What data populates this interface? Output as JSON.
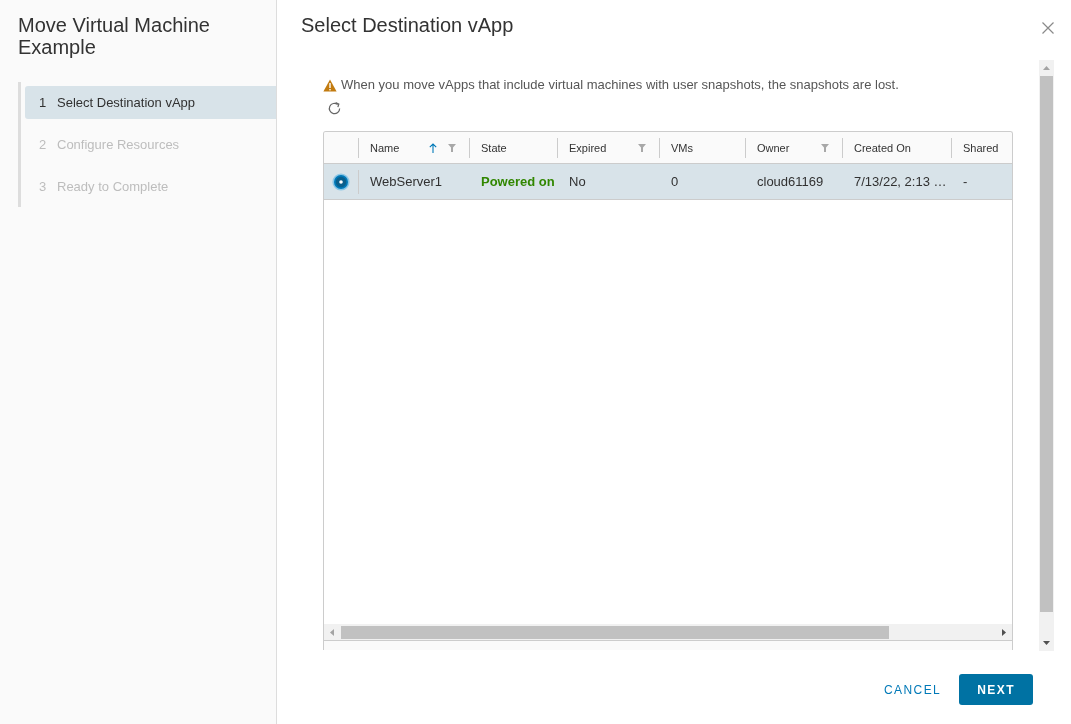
{
  "sidebar": {
    "title": "Move Virtual Machine Example",
    "steps": [
      {
        "number": "1",
        "label": "Select Destination vApp",
        "selected": true,
        "disabled": false
      },
      {
        "number": "2",
        "label": "Configure Resources",
        "selected": false,
        "disabled": true
      },
      {
        "number": "3",
        "label": "Ready to Complete",
        "selected": false,
        "disabled": true
      }
    ]
  },
  "dialog": {
    "title": "Select Destination vApp",
    "warning": "When you move vApps that include virtual machines with user snapshots, the snapshots are lost.",
    "table": {
      "columns": [
        {
          "label": "Name",
          "kind": "text",
          "sorted": true,
          "filterable": true
        },
        {
          "label": "State",
          "kind": "status",
          "sorted": false,
          "filterable": false
        },
        {
          "label": "Expired",
          "kind": "text",
          "sorted": false,
          "filterable": true
        },
        {
          "label": "VMs",
          "kind": "text",
          "sorted": false,
          "filterable": false
        },
        {
          "label": "Owner",
          "kind": "text",
          "sorted": false,
          "filterable": true
        },
        {
          "label": "Created On",
          "kind": "text",
          "sorted": false,
          "filterable": false
        },
        {
          "label": "Shared",
          "kind": "text",
          "sorted": false,
          "filterable": false
        }
      ],
      "rows": [
        {
          "selected": true,
          "cells": [
            "WebServer1",
            "Powered on",
            "No",
            "0",
            "cloud61169",
            "7/13/22, 2:13 …",
            "-"
          ]
        }
      ]
    },
    "buttons": [
      {
        "label": "CANCEL",
        "kind": "flat"
      },
      {
        "label": "NEXT",
        "kind": "primary"
      }
    ]
  }
}
